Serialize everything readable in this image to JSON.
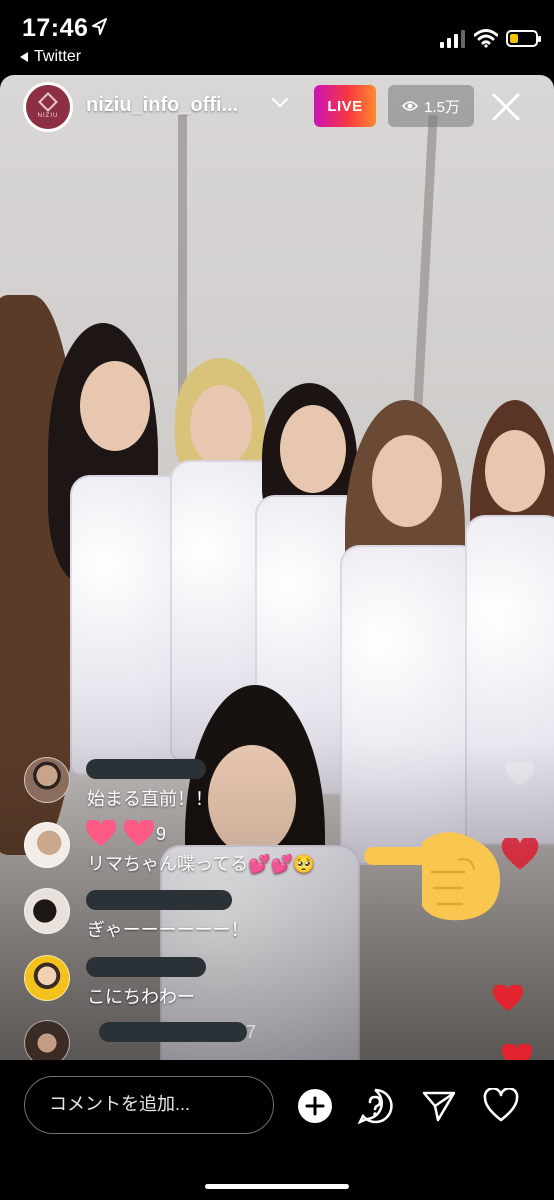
{
  "status_bar": {
    "time": "17:46",
    "back_app": "Twitter",
    "battery_color": "#f3c400"
  },
  "live_header": {
    "avatar_text": "NIZIU",
    "username": "niziu_info_offi...",
    "live_label": "LIVE",
    "viewer_count": "1.5万",
    "live_gradient": [
      "#c913b9",
      "#f9373f",
      "#fe8a2f"
    ]
  },
  "comments": [
    {
      "text": "始まる直前！！",
      "avatar": "sunglasses-user-avatar"
    },
    {
      "text": "リマちゃん喋ってる💕💕🥺",
      "avatar": "braided-hair-user-avatar",
      "name_partial": "9"
    },
    {
      "text": "ぎゃーーーーーー！",
      "avatar": "hair-back-user-avatar"
    },
    {
      "text": "こにちわわー",
      "avatar": "cartoon-girl-user-avatar"
    },
    {
      "text": "",
      "avatar": "partial-user-avatar",
      "name_partial": "7"
    }
  ],
  "composer": {
    "placeholder": "コメントを追加..."
  },
  "icons": {
    "add": "add-icon",
    "question": "question-icon",
    "share": "send-icon",
    "like": "heart-icon"
  }
}
